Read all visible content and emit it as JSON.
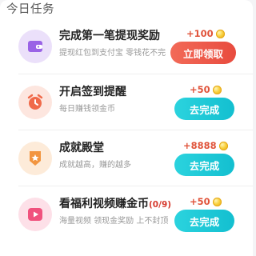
{
  "section": {
    "title": "今日任务"
  },
  "tasks": [
    {
      "title": "完成第一笔提现奖励",
      "description": "提现红包到支付宝 零钱花不完",
      "reward": "+100",
      "button": "立即领取",
      "icon": "wallet-icon",
      "icon_bg": "#ebe0fa",
      "icon_color": "#9a63e6"
    },
    {
      "title": "开启签到提醒",
      "description": "每日赚钱领金币",
      "reward": "+50",
      "button": "去完成",
      "icon": "alarm-clock-icon",
      "icon_bg": "#fde6df",
      "icon_color": "#f06a4a"
    },
    {
      "title": "成就殿堂",
      "description": "成就越高，赚的越多",
      "reward": "+8888",
      "button": "去完成",
      "icon": "badge-icon",
      "icon_bg": "#fdebd9",
      "icon_color": "#f29540"
    },
    {
      "title": "看福利视频赚金币",
      "progress": "(0/9)",
      "description": "海量视频 领现金奖励 上不封顶",
      "reward": "+50",
      "button": "去完成",
      "icon": "play-icon",
      "icon_bg": "#fde0e8",
      "icon_color": "#f0527e"
    }
  ],
  "colors": {
    "accent_red": "#ea5344",
    "accent_cyan": "#1cc8d6",
    "coin": "#f8cf3c"
  }
}
